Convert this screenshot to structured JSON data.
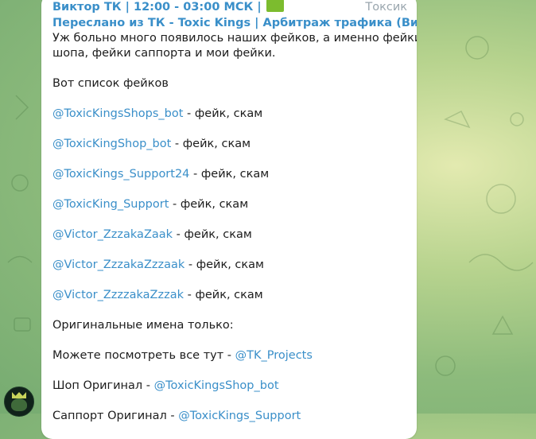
{
  "message": {
    "header": "Виктор ТК | 12:00 - 03:00 МСК |",
    "header_right": "Токсик",
    "forwarded_from": "Переслано из ТК - Toxic Kings | Арбитраж трафика (Виктор ТК)",
    "intro_line1": "Уж больно много появилось наших фейков, а именно фейки",
    "intro_line2": "шопа, фейки саппорта и мои фейки.",
    "list_title": "Вот список фейков",
    "fakes": [
      {
        "handle": "@ToxicKingsShops_bot",
        "note": " - фейк, скам"
      },
      {
        "handle": "@ToxicKingShop_bot",
        "note": " - фейк, скам"
      },
      {
        "handle": "@ToxicKings_Support24",
        "note": " - фейк, скам"
      },
      {
        "handle": "@ToxicKing_Support",
        "note": " - фейк, скам"
      },
      {
        "handle": "@Victor_ZzzakaZaak",
        "note": " - фейк, скам"
      },
      {
        "handle": "@Victor_ZzzakaZzzaak",
        "note": " - фейк, скам"
      },
      {
        "handle": "@Victor_ZzzzakaZzzak",
        "note": " - фейк, скам"
      }
    ],
    "originals_title": "Оригинальные имена только:",
    "view_all_text": "Можете посмотреть все тут - ",
    "view_all_link": "@TK_Projects",
    "shop_text": "Шоп Оригинал - ",
    "shop_link": "@ToxicKingsShop_bot",
    "support_text": "Саппорт Оригинал - ",
    "support_link": "@ToxicKings_Support"
  },
  "colors": {
    "link": "#3a8fc9",
    "text": "#1c1c1c",
    "bubble": "#ffffff",
    "background": "#8dbb7c"
  }
}
